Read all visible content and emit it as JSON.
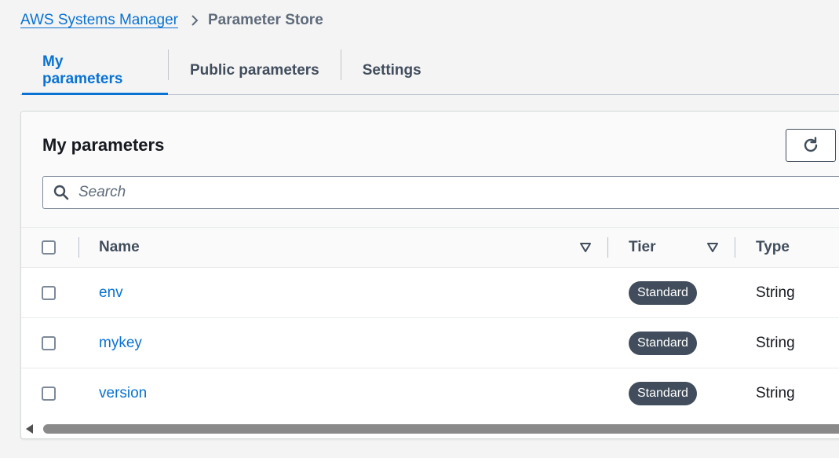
{
  "breadcrumb": {
    "parent": "AWS Systems Manager",
    "current": "Parameter Store"
  },
  "tabs": [
    {
      "label": "My parameters",
      "active": true
    },
    {
      "label": "Public parameters",
      "active": false
    },
    {
      "label": "Settings",
      "active": false
    }
  ],
  "panel": {
    "title": "My parameters",
    "refresh_icon": "refresh-icon"
  },
  "search": {
    "placeholder": "Search",
    "value": ""
  },
  "table": {
    "columns": [
      "Name",
      "Tier",
      "Type"
    ],
    "rows": [
      {
        "name": "env",
        "tier": "Standard",
        "type": "String"
      },
      {
        "name": "mykey",
        "tier": "Standard",
        "type": "String"
      },
      {
        "name": "version",
        "tier": "Standard",
        "type": "String"
      }
    ]
  },
  "colors": {
    "link": "#0972d3",
    "badge_bg": "#414d5c",
    "text": "#16191f"
  }
}
